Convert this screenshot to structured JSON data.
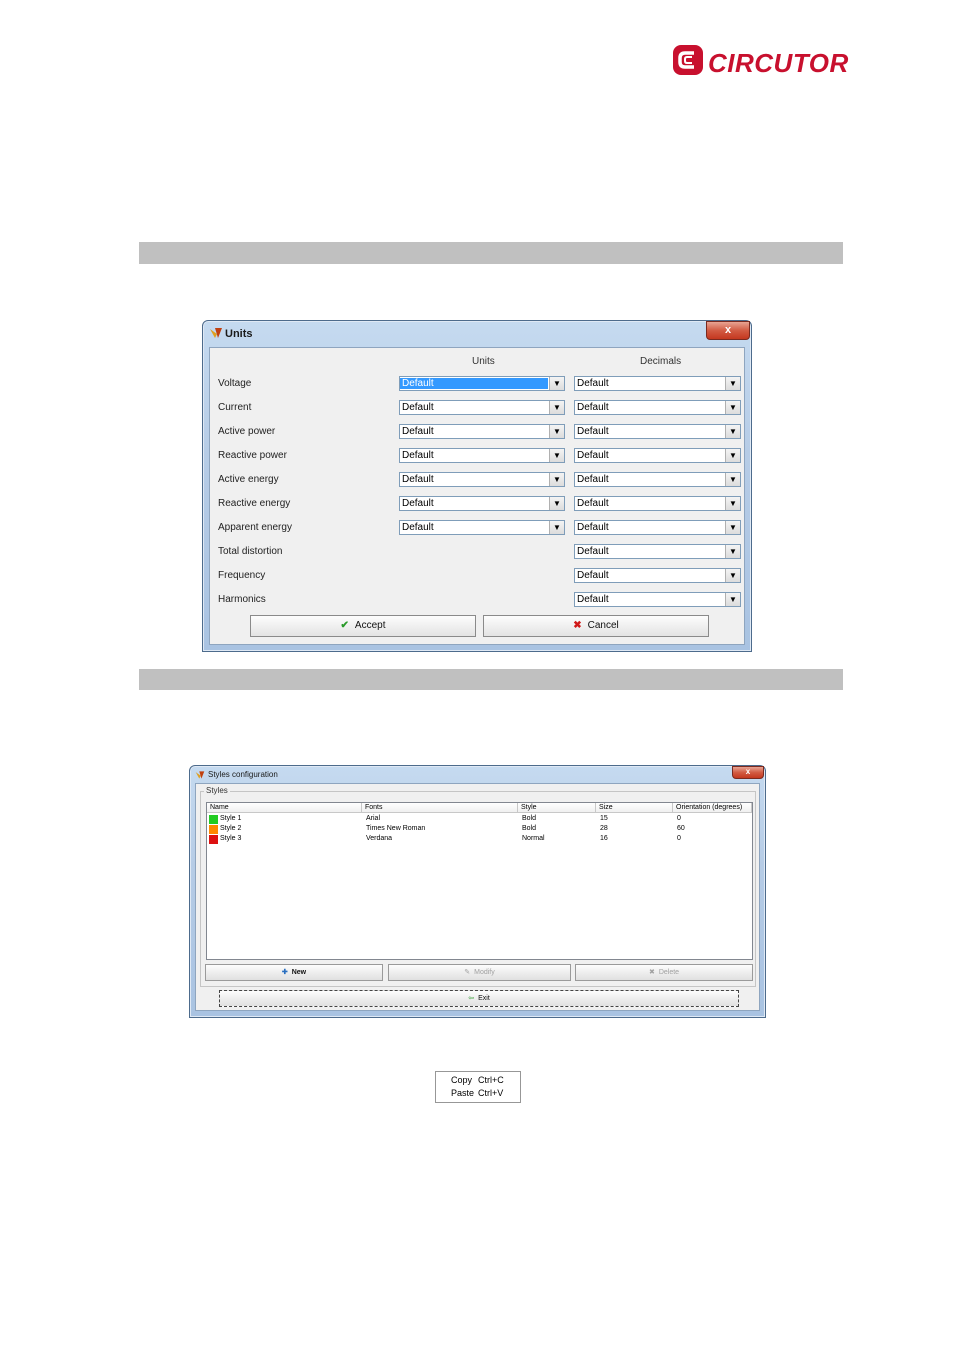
{
  "logo": {
    "text": "CIRCUTOR"
  },
  "units_dialog": {
    "title": "Units",
    "close_label": "x",
    "col_units": "Units",
    "col_decimals": "Decimals",
    "rows": [
      {
        "label": "Voltage",
        "units": "Default",
        "decimals": "Default"
      },
      {
        "label": "Current",
        "units": "Default",
        "decimals": "Default"
      },
      {
        "label": "Active power",
        "units": "Default",
        "decimals": "Default"
      },
      {
        "label": "Reactive power",
        "units": "Default",
        "decimals": "Default"
      },
      {
        "label": "Active energy",
        "units": "Default",
        "decimals": "Default"
      },
      {
        "label": "Reactive energy",
        "units": "Default",
        "decimals": "Default"
      },
      {
        "label": "Apparent energy",
        "units": "Default",
        "decimals": "Default"
      },
      {
        "label": "Total distortion",
        "units": null,
        "decimals": "Default"
      },
      {
        "label": "Frequency",
        "units": null,
        "decimals": "Default"
      },
      {
        "label": "Harmonics",
        "units": null,
        "decimals": "Default"
      }
    ],
    "accept_label": "Accept",
    "cancel_label": "Cancel"
  },
  "styles_dialog": {
    "title": "Styles configuration",
    "close_label": "x",
    "group_label": "Styles",
    "columns": [
      "Name",
      "Fonts",
      "Style",
      "Size",
      "Orientation (degrees)"
    ],
    "rows": [
      {
        "name": "Style 1",
        "font": "Arial",
        "style": "Bold",
        "size": "15",
        "orientation": "0",
        "color": "#22cc22"
      },
      {
        "name": "Style 2",
        "font": "Times New Roman",
        "style": "Bold",
        "size": "28",
        "orientation": "60",
        "color": "#ff8800"
      },
      {
        "name": "Style 3",
        "font": "Verdana",
        "style": "Normal",
        "size": "16",
        "orientation": "0",
        "color": "#dd1111"
      }
    ],
    "new_label": "New",
    "modify_label": "Modify",
    "delete_label": "Delete",
    "exit_label": "Exit"
  },
  "context_menu": {
    "items": [
      {
        "label": "Copy",
        "shortcut": "Ctrl+C"
      },
      {
        "label": "Paste",
        "shortcut": "Ctrl+V"
      }
    ]
  }
}
